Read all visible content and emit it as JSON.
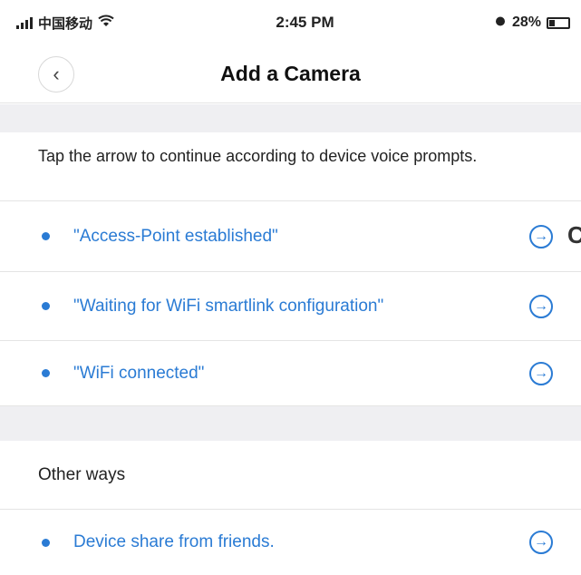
{
  "status_bar": {
    "carrier": "中国移动",
    "time": "2:45 PM",
    "battery_text": "28%",
    "battery_level": 0.28
  },
  "nav": {
    "title": "Add a Camera",
    "back_glyph": "‹"
  },
  "instructions": "Tap the arrow to continue according to device voice prompts.",
  "prompts": [
    {
      "label": "\"Access-Point established\""
    },
    {
      "label": "\"Waiting for WiFi smartlink configuration\""
    },
    {
      "label": "\"WiFi connected\""
    }
  ],
  "other_ways": {
    "heading": "Other ways",
    "items": [
      {
        "label": "Device share from friends."
      }
    ]
  },
  "edge_glyph": "C",
  "icons": {
    "arrow": "arrow-circle-right-icon",
    "arrow_glyph": "→"
  },
  "colors": {
    "accent": "#2a7bd4",
    "band": "#efeff2"
  }
}
